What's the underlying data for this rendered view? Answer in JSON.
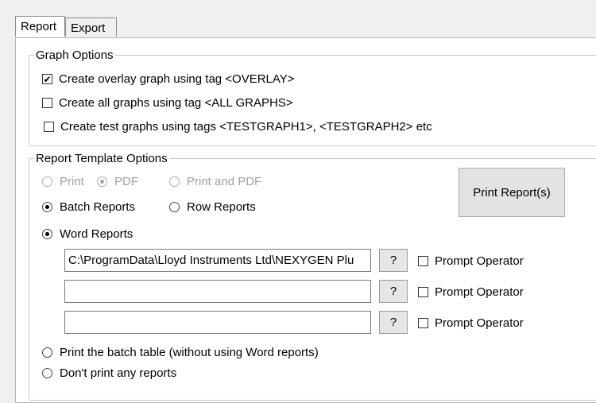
{
  "tabs": [
    {
      "label": "Report",
      "active": true
    },
    {
      "label": "Export",
      "active": false
    }
  ],
  "graph_options": {
    "title": "Graph Options",
    "items": [
      {
        "label": "Create overlay graph using tag <OVERLAY>",
        "checked": true
      },
      {
        "label": "Create all graphs using tag <ALL GRAPHS>",
        "checked": false
      },
      {
        "label": "Create test graphs using tags <TESTGRAPH1>, <TESTGRAPH2> etc",
        "checked": false
      }
    ]
  },
  "report_template": {
    "title": "Report Template Options",
    "output_options": [
      {
        "label": "Print",
        "selected": false,
        "disabled": true
      },
      {
        "label": "PDF",
        "selected": true,
        "disabled": true
      },
      {
        "label": "Print and PDF",
        "selected": false,
        "disabled": true
      }
    ],
    "batch_reports_label": "Batch Reports",
    "row_reports_label": "Row Reports",
    "print_button_label": "Print Report(s)",
    "word_reports_label": "Word Reports",
    "templates": [
      {
        "value": "C:\\ProgramData\\Lloyd Instruments Ltd\\NEXYGEN Plu",
        "prompt_label": "Prompt Operator",
        "prompt_checked": false
      },
      {
        "value": "",
        "prompt_label": "Prompt Operator",
        "prompt_checked": false
      },
      {
        "value": "",
        "prompt_label": "Prompt Operator",
        "prompt_checked": false
      }
    ],
    "help_button_label": "?",
    "print_batch_table_label": "Print the batch table (without using Word reports)",
    "dont_print_label": "Don't print any reports",
    "selected_mode": "word_reports",
    "selected_type": "batch_reports"
  },
  "colors": {
    "background": "#f0f0f0",
    "panel": "#ffffff",
    "disabled_text": "#a0a0a0"
  }
}
